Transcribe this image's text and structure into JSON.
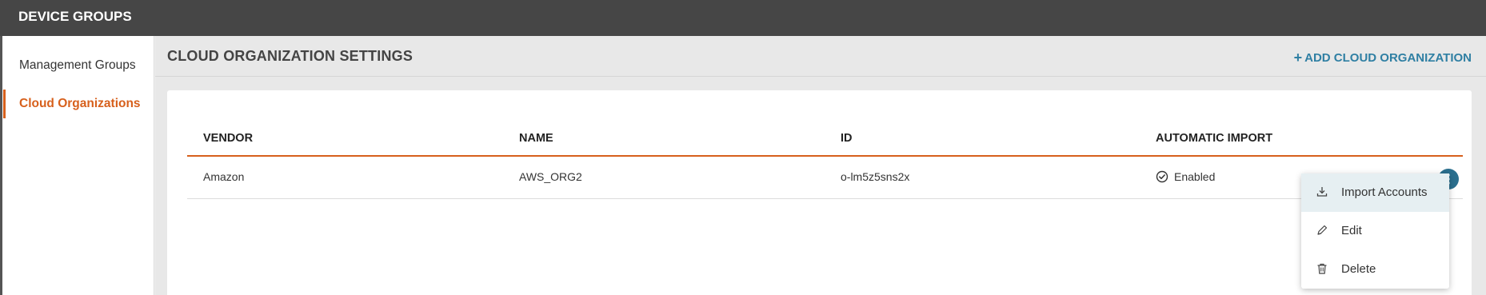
{
  "topbar": {
    "title": "DEVICE GROUPS"
  },
  "sidebar": {
    "items": [
      {
        "label": "Management Groups"
      },
      {
        "label": "Cloud Organizations"
      }
    ]
  },
  "main": {
    "title": "CLOUD ORGANIZATION SETTINGS",
    "add_label": "ADD CLOUD ORGANIZATION",
    "add_glyph": "+"
  },
  "table": {
    "columns": [
      "VENDOR",
      "NAME",
      "ID",
      "AUTOMATIC IMPORT"
    ],
    "rows": [
      {
        "vendor": "Amazon",
        "name": "AWS_ORG2",
        "id": "o-lm5z5sns2x",
        "auto_import": "Enabled"
      }
    ]
  },
  "row_menu": {
    "items": [
      {
        "label": "Import Accounts",
        "icon": "download-icon"
      },
      {
        "label": "Edit",
        "icon": "pencil-icon"
      },
      {
        "label": "Delete",
        "icon": "trash-icon"
      }
    ]
  },
  "colors": {
    "accent": "#d7601c",
    "link": "#2f7fa3",
    "topbar": "#464646"
  }
}
